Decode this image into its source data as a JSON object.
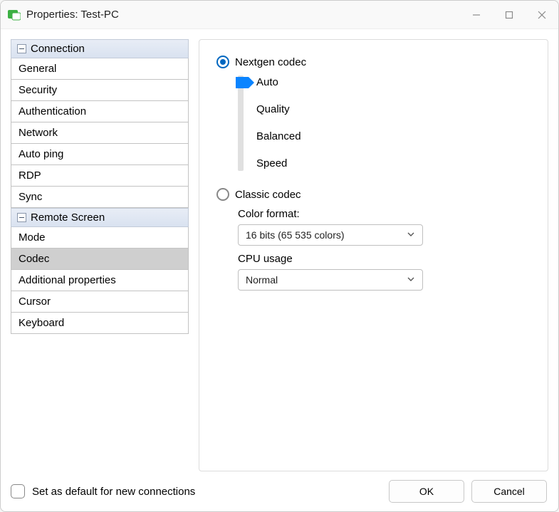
{
  "window": {
    "title": "Properties: Test-PC"
  },
  "sidebar": {
    "sections": [
      {
        "title": "Connection",
        "items": [
          "General",
          "Security",
          "Authentication",
          "Network",
          "Auto ping",
          "RDP",
          "Sync"
        ]
      },
      {
        "title": "Remote Screen",
        "items": [
          "Mode",
          "Codec",
          "Additional properties",
          "Cursor",
          "Keyboard"
        ],
        "selected_index": 1
      }
    ]
  },
  "main": {
    "nextgen": {
      "label": "Nextgen codec",
      "selected": true,
      "options": [
        "Auto",
        "Quality",
        "Balanced",
        "Speed"
      ],
      "current_index": 0
    },
    "classic": {
      "label": "Classic codec",
      "selected": false,
      "color_format_label": "Color format:",
      "color_format_value": "16 bits (65 535 colors)",
      "cpu_usage_label": "CPU usage",
      "cpu_usage_value": "Normal"
    }
  },
  "footer": {
    "default_label": "Set as default for new connections",
    "default_checked": false,
    "ok": "OK",
    "cancel": "Cancel"
  }
}
